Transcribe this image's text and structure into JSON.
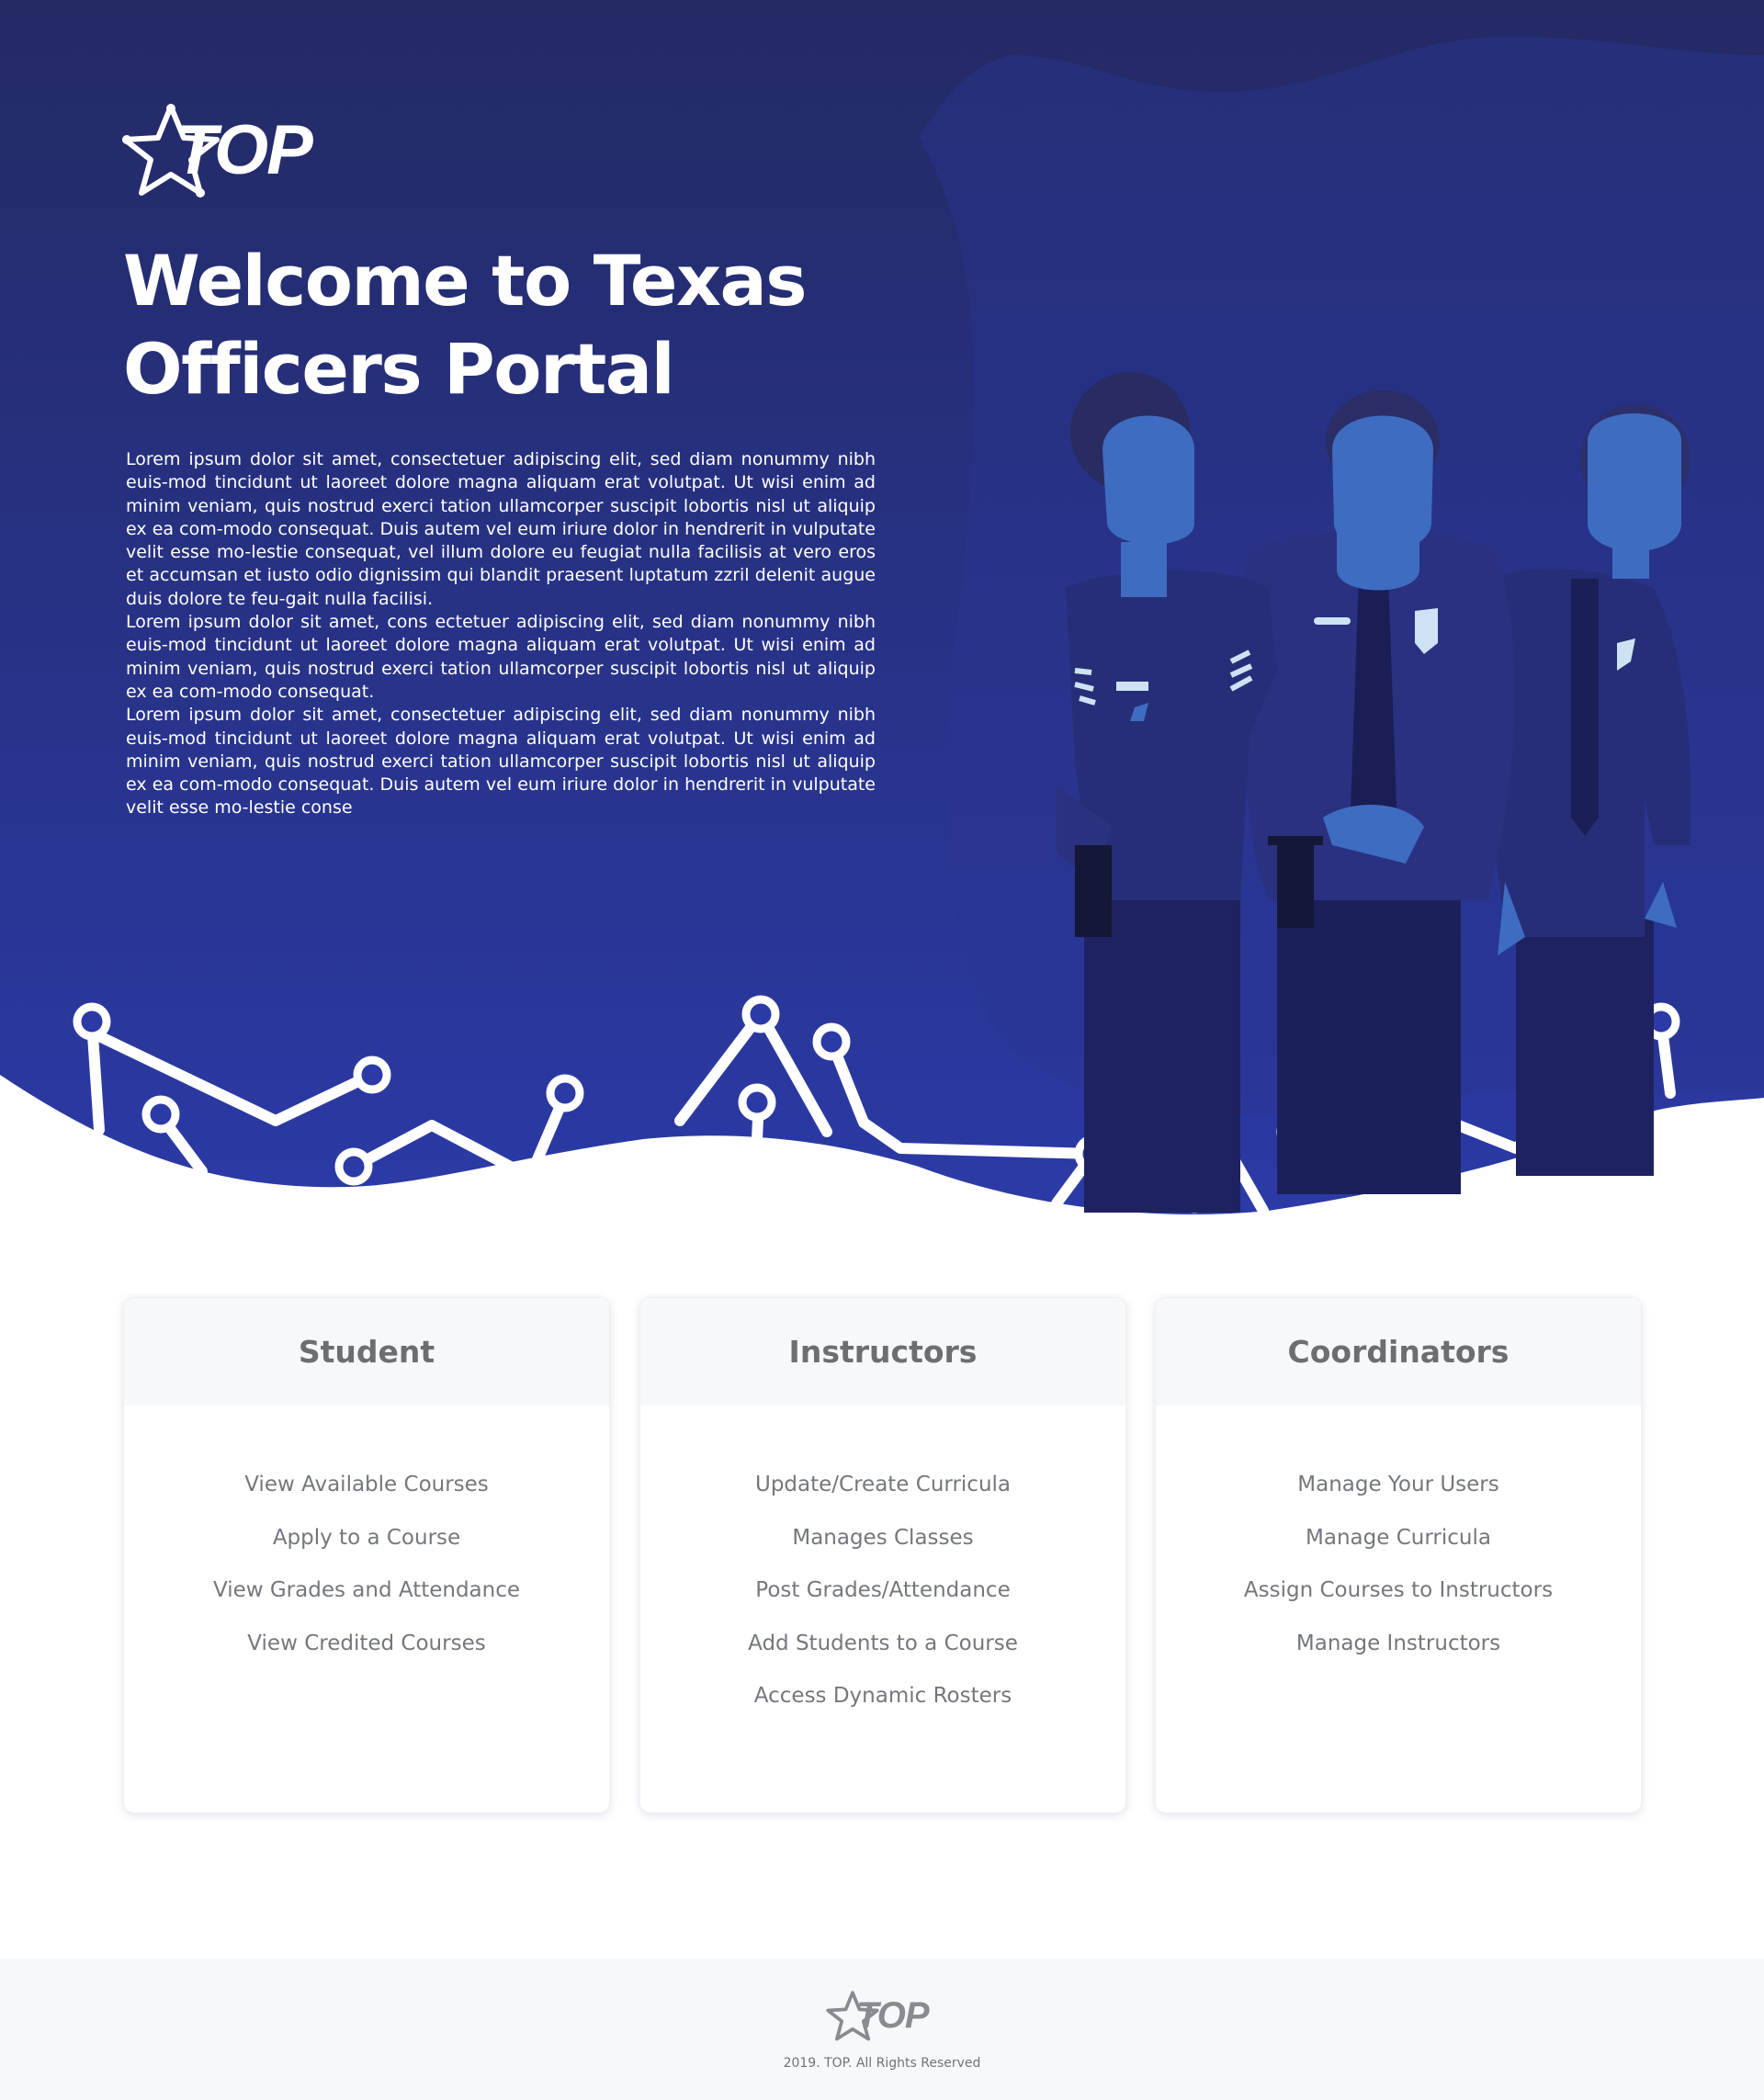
{
  "brand": {
    "logo_text": "TOP",
    "icon": "star-badge-icon"
  },
  "hero": {
    "title_line1": "Welcome to Texas",
    "title_line2": "Officers Portal",
    "paragraphs": [
      "Lorem ipsum dolor sit amet, consectetuer adipiscing elit, sed diam nonummy nibh euis-mod tincidunt ut laoreet dolore magna aliquam erat volutpat. Ut wisi enim ad minim veniam, quis nostrud exerci tation ullamcorper suscipit lobortis nisl ut aliquip ex ea com-modo consequat. Duis autem vel eum iriure dolor in hendrerit in vulputate velit esse mo-lestie consequat, vel illum dolore eu feugiat nulla facilisis at vero eros et accumsan et iusto odio dignissim qui blandit praesent luptatum zzril delenit augue duis dolore te feu-gait nulla facilisi.",
      "Lorem ipsum dolor sit amet, cons ectetuer adipiscing elit, sed diam nonummy nibh euis-mod tincidunt ut laoreet dolore magna aliquam erat volutpat. Ut wisi enim ad minim veniam, quis nostrud exerci tation ullamcorper suscipit lobortis nisl ut aliquip ex ea com-modo consequat.",
      "Lorem ipsum dolor sit amet, consectetuer adipiscing elit, sed diam nonummy nibh euis-mod tincidunt ut laoreet dolore magna aliquam erat volutpat. Ut wisi enim ad minim veniam, quis nostrud exerci tation ullamcorper suscipit lobortis nisl ut aliquip ex ea com-modo consequat. Duis autem vel eum iriure dolor in hendrerit in vulputate velit esse mo-lestie conse"
    ]
  },
  "cards": {
    "student": {
      "title": "Student",
      "items": [
        "View Available Courses",
        "Apply to a Course",
        "View Grades and Attendance",
        "View Credited Courses"
      ]
    },
    "instructors": {
      "title": "Instructors",
      "items": [
        "Update/Create Curricula",
        "Manages Classes",
        "Post Grades/Attendance",
        "Add Students to a Course",
        "Access Dynamic Rosters"
      ]
    },
    "coordinators": {
      "title": "Coordinators",
      "items": [
        "Manage Your Users",
        "Manage Curricula",
        "Assign Courses to Instructors",
        "Manage Instructors"
      ]
    }
  },
  "footer": {
    "logo_text": "TOP",
    "copyright": "2019. TOP. All Rights Reserved"
  },
  "colors": {
    "hero_top": "#222a66",
    "hero_bottom": "#2b3aa2",
    "accent_blue": "#3e6cc0",
    "text_gray": "#6d6e71"
  }
}
